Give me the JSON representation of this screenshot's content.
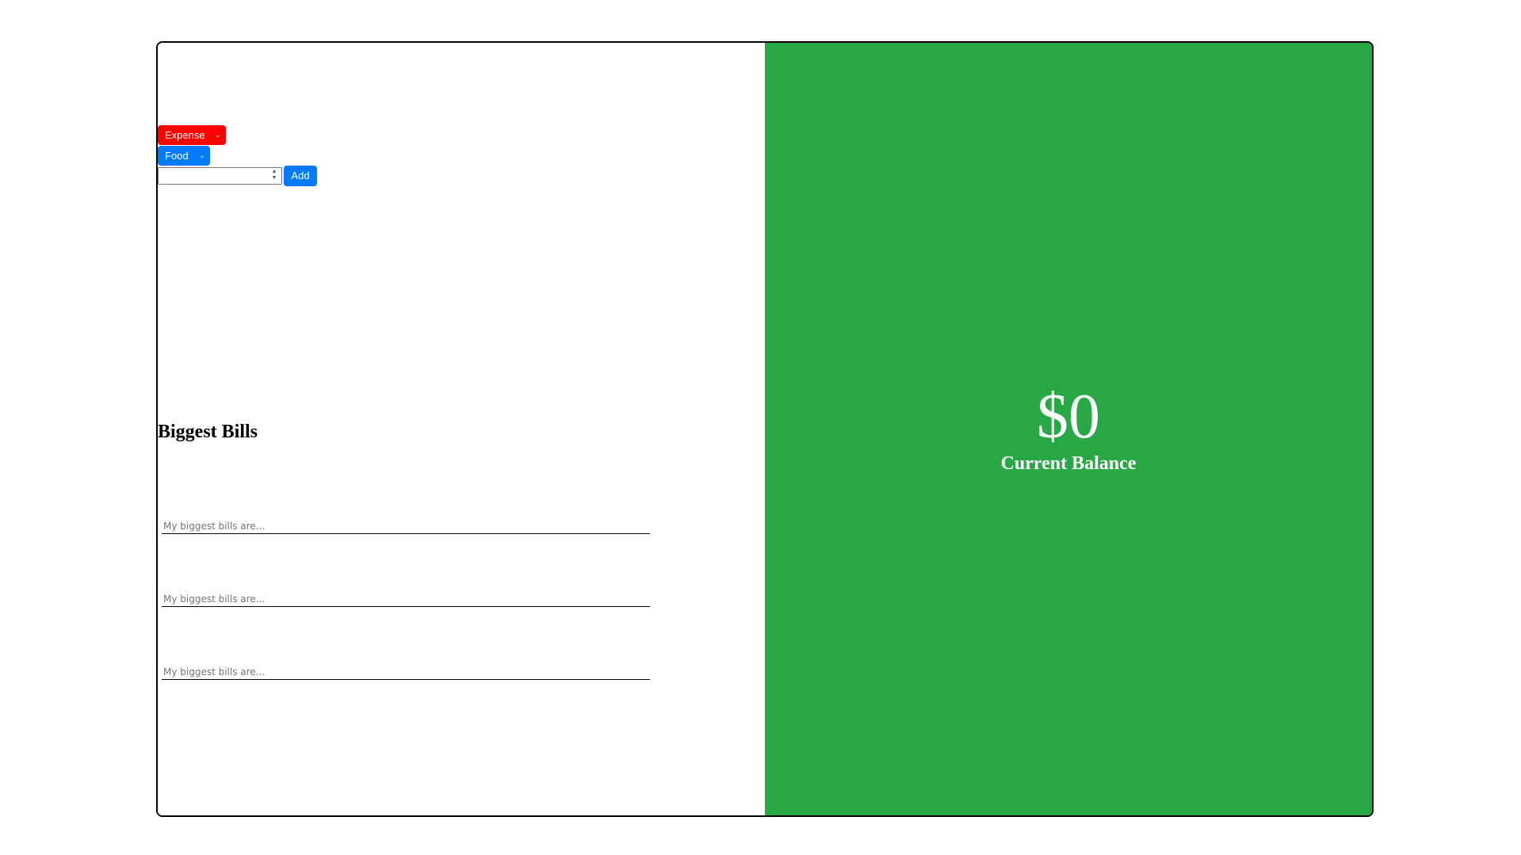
{
  "form": {
    "type_select": {
      "value": "Expense",
      "color": "#ff0000"
    },
    "category_select": {
      "value": "Food",
      "color": "#007bff"
    },
    "amount_input": {
      "value": ""
    },
    "add_button_label": "Add"
  },
  "bills": {
    "heading": "Biggest Bills",
    "fields": [
      {
        "placeholder": "My biggest bills are..."
      },
      {
        "placeholder": "My biggest bills are..."
      },
      {
        "placeholder": "My biggest bills are..."
      }
    ]
  },
  "balance": {
    "amount": "$0",
    "label": "Current Balance",
    "panel_color": "#28a745"
  },
  "icons": {
    "dropdown": "chevron-down-icon",
    "spinner": "spinner-arrows-icon"
  }
}
